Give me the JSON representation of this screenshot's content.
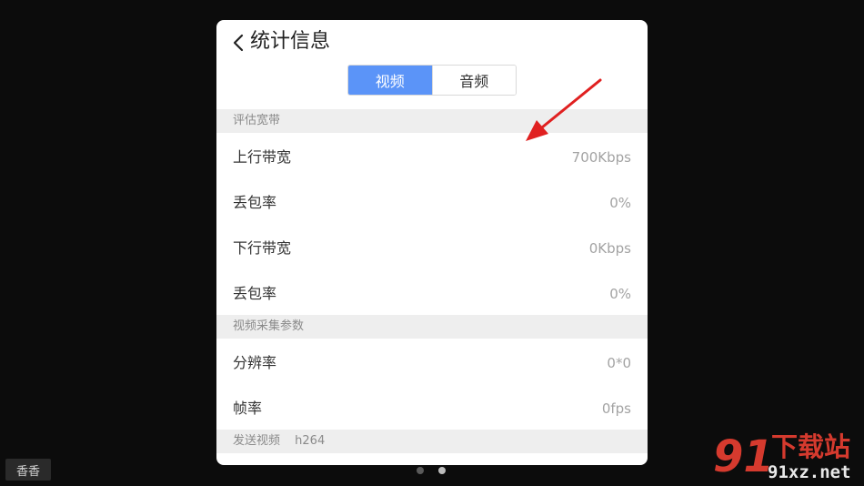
{
  "header": {
    "title": "统计信息"
  },
  "tabs": [
    {
      "label": "视频",
      "active": true
    },
    {
      "label": "音频",
      "active": false
    }
  ],
  "sections": {
    "bandwidth": {
      "title": "评估宽带"
    },
    "capture": {
      "title": "视频采集参数"
    },
    "send": {
      "title": "发送视频",
      "codec": "h264"
    }
  },
  "rows": {
    "upload_bandwidth": {
      "label": "上行带宽",
      "value": "700Kbps"
    },
    "upload_loss": {
      "label": "丢包率",
      "value": "0%"
    },
    "download_bandwidth": {
      "label": "下行带宽",
      "value": "0Kbps"
    },
    "download_loss": {
      "label": "丢包率",
      "value": "0%"
    },
    "resolution": {
      "label": "分辨率",
      "value": "0*0"
    },
    "frame_rate": {
      "label": "帧率",
      "value": "0fps"
    }
  },
  "user_tag": {
    "label": "香香"
  },
  "pager": {
    "count": 2,
    "active_index": 1
  },
  "watermark": {
    "logo_digits": "91",
    "name": "下载站",
    "url": "91xz.net"
  },
  "colors": {
    "accent": "#5b94f8",
    "annotation": "#e02020",
    "watermark": "#d53a2e"
  }
}
